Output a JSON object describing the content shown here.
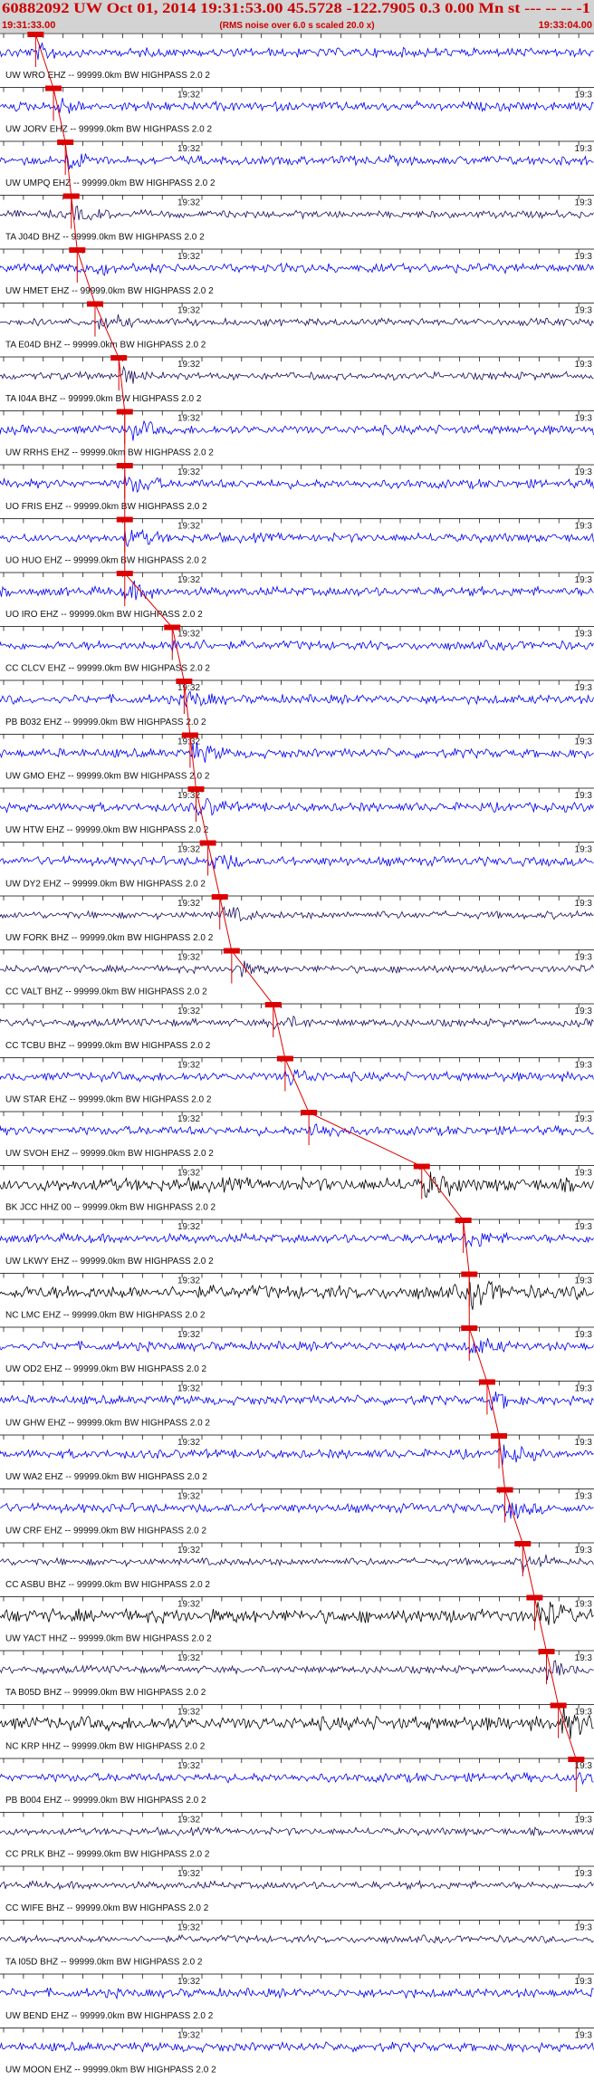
{
  "header": {
    "event_line": "60882092 UW Oct 01, 2014 19:31:53.00    45.5728 -122.7905  0.3 0.00 Mn st --- -- --   -1",
    "start_time": "19:31:33.00",
    "end_time": "19:33:04.00",
    "note": "(RMS noise over 6.0 s scaled 20.0 x)"
  },
  "time_label": "19:32",
  "time_label_right": "19:3",
  "station_suffix": "-- 99999.0km BW  HIGHPASS  2.0  2",
  "colors": {
    "header_bg": "#d3d3d3",
    "header_text": "#cc0000",
    "trace_blue": "#0000ee",
    "trace_navy": "#1a1060",
    "trace_black": "#000000",
    "pick": "#dd0000"
  },
  "traces": [
    {
      "station": "UW WRO EHZ",
      "color": "blue",
      "pick": 0.06
    },
    {
      "station": "UW JORV EHZ",
      "color": "blue",
      "pick": 0.09
    },
    {
      "station": "UW UMPQ EHZ",
      "color": "blue",
      "pick": 0.11
    },
    {
      "station": "TA J04D BHZ",
      "color": "navy",
      "pick": 0.12
    },
    {
      "station": "UW HMET EHZ",
      "color": "blue",
      "pick": 0.13
    },
    {
      "station": "TA E04D BHZ",
      "color": "navy",
      "pick": 0.16
    },
    {
      "station": "TA I04A BHZ",
      "color": "navy",
      "pick": 0.2
    },
    {
      "station": "UW RRHS EHZ",
      "color": "blue",
      "pick": 0.21
    },
    {
      "station": "UO FRIS EHZ",
      "color": "blue",
      "pick": 0.21
    },
    {
      "station": "UO HUO EHZ",
      "color": "blue",
      "pick": 0.21
    },
    {
      "station": "UO IRO EHZ",
      "color": "blue",
      "pick": 0.21
    },
    {
      "station": "CC CLCV EHZ",
      "color": "blue",
      "pick": 0.29
    },
    {
      "station": "PB B032 EHZ",
      "color": "blue",
      "pick": 0.31
    },
    {
      "station": "UW GMO EHZ",
      "color": "blue",
      "pick": 0.32
    },
    {
      "station": "UW HTW EHZ",
      "color": "blue",
      "pick": 0.33
    },
    {
      "station": "UW DY2 EHZ",
      "color": "blue",
      "pick": 0.35
    },
    {
      "station": "UW FORK BHZ",
      "color": "navy",
      "pick": 0.37
    },
    {
      "station": "CC VALT BHZ",
      "color": "navy",
      "pick": 0.39
    },
    {
      "station": "CC TCBU BHZ",
      "color": "navy",
      "pick": 0.46
    },
    {
      "station": "UW STAR EHZ",
      "color": "blue",
      "pick": 0.48
    },
    {
      "station": "UW SVOH EHZ",
      "color": "blue",
      "pick": 0.52
    },
    {
      "station": "BK JCC HHZ 00",
      "color": "black",
      "pick": 0.71
    },
    {
      "station": "UW LKWY EHZ",
      "color": "blue",
      "pick": 0.78
    },
    {
      "station": "NC LMC EHZ",
      "color": "black",
      "pick": 0.79
    },
    {
      "station": "UW OD2 EHZ",
      "color": "blue",
      "pick": 0.79
    },
    {
      "station": "UW GHW EHZ",
      "color": "blue",
      "pick": 0.82
    },
    {
      "station": "UW WA2 EHZ",
      "color": "blue",
      "pick": 0.84
    },
    {
      "station": "UW CRF EHZ",
      "color": "blue",
      "pick": 0.85
    },
    {
      "station": "CC ASBU BHZ",
      "color": "navy",
      "pick": 0.88
    },
    {
      "station": "UW YACT HHZ",
      "color": "black",
      "pick": 0.9
    },
    {
      "station": "TA B05D BHZ",
      "color": "navy",
      "pick": 0.92
    },
    {
      "station": "NC KRP HHZ",
      "color": "black",
      "pick": 0.94
    },
    {
      "station": "PB B004 EHZ",
      "color": "blue",
      "pick": 0.97
    },
    {
      "station": "CC PRLK BHZ",
      "color": "navy",
      "pick": null
    },
    {
      "station": "CC WIFE BHZ",
      "color": "navy",
      "pick": null
    },
    {
      "station": "TA I05D BHZ",
      "color": "navy",
      "pick": null
    },
    {
      "station": "UW BEND EHZ",
      "color": "blue",
      "pick": null
    },
    {
      "station": "UW MOON EHZ",
      "color": "blue",
      "pick": null
    }
  ]
}
